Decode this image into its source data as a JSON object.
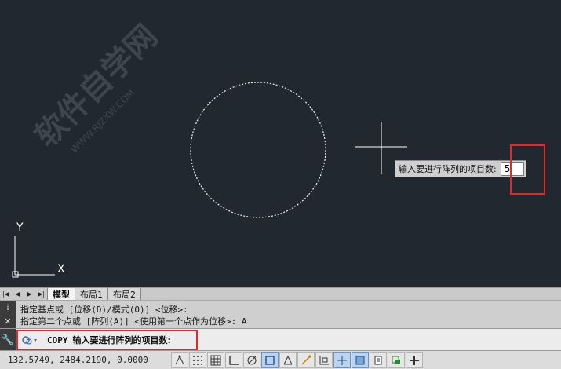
{
  "canvas": {
    "dynamic_prompt": {
      "label": "输入要进行阵列的项目数:",
      "value": "5"
    },
    "ucs": {
      "y_label": "Y",
      "x_label": "X"
    },
    "watermark": "软件自学网",
    "watermark_url": "WWW.RJZXW.COM"
  },
  "tabs": {
    "items": [
      "模型",
      "布局1",
      "布局2"
    ],
    "active": "模型"
  },
  "history": {
    "lines": [
      "指定基点或 [位移(D)/模式(O)] <位移>:",
      "指定第二个点或 [阵列(A)] <使用第一个点作为位移>: A"
    ]
  },
  "command": {
    "name": "COPY",
    "prompt": "输入要进行阵列的项目数:"
  },
  "status": {
    "coordinates": "132.5749, 2484.2190, 0.0000"
  },
  "toolbar_icons": [
    "infer-constraints-icon",
    "snap-mode-icon",
    "grid-display-icon",
    "ortho-mode-icon",
    "polar-tracking-icon",
    "object-snap-icon",
    "3d-object-snap-icon",
    "object-snap-tracking-icon",
    "dynamic-ucs-icon",
    "dynamic-input-icon",
    "lineweight-icon",
    "transparency-icon",
    "quick-properties-icon",
    "selection-cycling-icon",
    "annotation-monitor-icon"
  ],
  "colors": {
    "canvas_bg": "#212830",
    "highlight": "#e52727"
  }
}
